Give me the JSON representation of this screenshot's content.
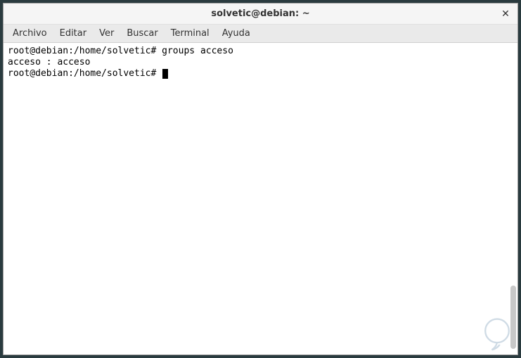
{
  "window": {
    "title": "solvetic@debian: ~"
  },
  "menubar": {
    "items": [
      {
        "label": "Archivo"
      },
      {
        "label": "Editar"
      },
      {
        "label": "Ver"
      },
      {
        "label": "Buscar"
      },
      {
        "label": "Terminal"
      },
      {
        "label": "Ayuda"
      }
    ]
  },
  "terminal": {
    "lines": [
      {
        "prompt": "root@debian:/home/solvetic#",
        "command": "groups acceso"
      },
      {
        "output": "acceso : acceso"
      },
      {
        "prompt": "root@debian:/home/solvetic#",
        "command": "",
        "cursor": true
      }
    ]
  }
}
